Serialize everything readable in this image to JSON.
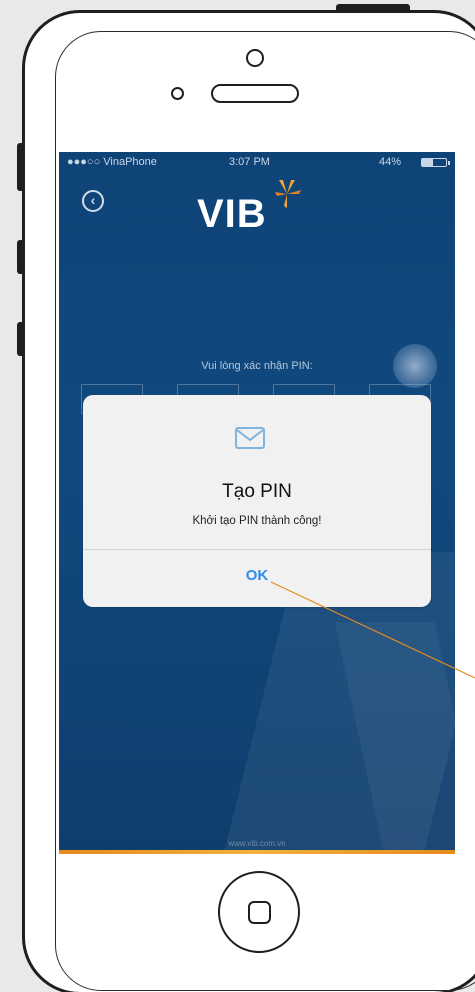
{
  "status_bar": {
    "carrier": "●●●○○ VinaPhone ",
    "time": "3:07 PM",
    "battery": "44%"
  },
  "app": {
    "logo": "VIB",
    "pin_prompt": "Vui lòng xác nhận PIN:",
    "website": "www.vib.com.vn"
  },
  "dialog": {
    "icon": "envelope-icon",
    "title": "Tạo PIN",
    "message": "Khởi tạo PIN thành công!",
    "ok_label": "OK"
  },
  "colors": {
    "screen_background": "#0e4377",
    "accent_ok": "#2b8cea",
    "logo_accent": "#f2a33a",
    "annotation_line": "#e58a1a"
  }
}
